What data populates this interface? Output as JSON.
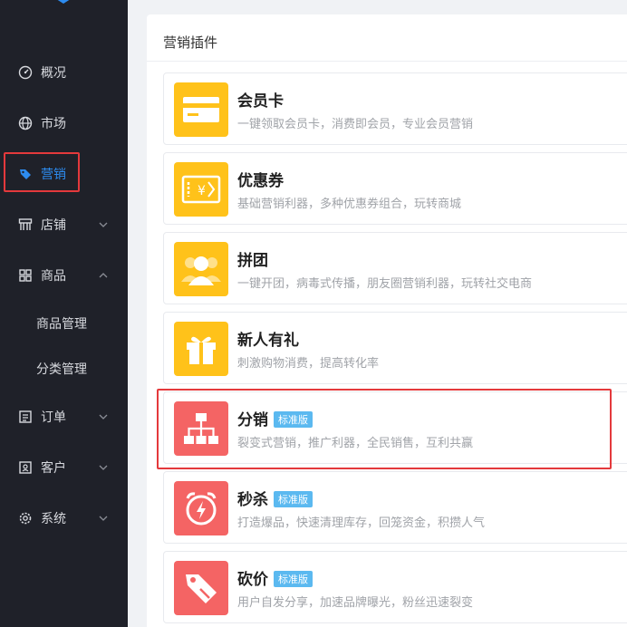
{
  "sidebar": {
    "items": [
      {
        "label": "概况",
        "icon": "gauge-icon"
      },
      {
        "label": "市场",
        "icon": "globe-icon"
      },
      {
        "label": "营销",
        "icon": "tag-icon",
        "active": true
      },
      {
        "label": "店铺",
        "icon": "storefront-icon",
        "expandable": true
      },
      {
        "label": "商品",
        "icon": "grid-icon",
        "expanded": true
      },
      {
        "label": "订单",
        "icon": "list-icon",
        "expandable": true
      },
      {
        "label": "客户",
        "icon": "customer-icon",
        "expandable": true
      },
      {
        "label": "系统",
        "icon": "gear-icon",
        "expandable": true
      }
    ],
    "subitems": [
      {
        "label": "商品管理"
      },
      {
        "label": "分类管理"
      }
    ]
  },
  "panel": {
    "title": "营销插件"
  },
  "plugins": [
    {
      "name": "会员卡",
      "desc": "一键领取会员卡，消费即会员，专业会员营销",
      "icon": "card-icon",
      "color": "#ffc21a"
    },
    {
      "name": "优惠券",
      "desc": "基础营销利器，多种优惠券组合，玩转商城",
      "icon": "coupon-icon",
      "color": "#ffc21a"
    },
    {
      "name": "拼团",
      "desc": "一键开团，病毒式传播，朋友圈营销利器，玩转社交电商",
      "icon": "group-icon",
      "color": "#ffc21a"
    },
    {
      "name": "新人有礼",
      "desc": "刺激购物消费，提高转化率",
      "icon": "gift-icon",
      "color": "#ffc21a"
    },
    {
      "name": "分销",
      "badge": "标准版",
      "desc": "裂变式营销，推广利器，全民销售，互利共赢",
      "icon": "hierarchy-icon",
      "color": "#f46464"
    },
    {
      "name": "秒杀",
      "badge": "标准版",
      "desc": "打造爆品，快速清理库存，回笼资金，积攒人气",
      "icon": "alarm-clock-icon",
      "color": "#f46464"
    },
    {
      "name": "砍价",
      "badge": "标准版",
      "desc": "用户自发分享，加速品牌曝光，粉丝迅速裂变",
      "icon": "price-tag-icon",
      "color": "#f46464"
    }
  ]
}
